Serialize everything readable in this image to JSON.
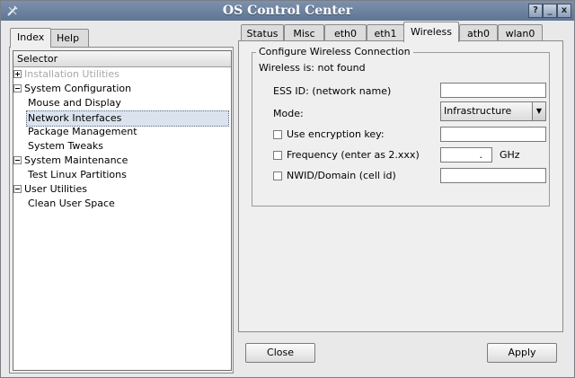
{
  "window": {
    "title": "OS Control Center"
  },
  "titlebar_buttons": {
    "help": "?",
    "minimize": "_",
    "close": "x"
  },
  "left_tabs": [
    {
      "label": "Index"
    },
    {
      "label": "Help"
    }
  ],
  "tree": {
    "header": "Selector",
    "items": [
      {
        "label": "Installation Utilities",
        "expander": "+",
        "disabled": true
      },
      {
        "label": "System Configuration",
        "expander": "-"
      },
      {
        "label": "Mouse and Display"
      },
      {
        "label": "Network Interfaces",
        "selected": true
      },
      {
        "label": "Package Management"
      },
      {
        "label": "System Tweaks"
      },
      {
        "label": "System Maintenance",
        "expander": "-"
      },
      {
        "label": "Test Linux Partitions"
      },
      {
        "label": "User Utilities",
        "expander": "-"
      },
      {
        "label": "Clean User Space"
      }
    ]
  },
  "right_tabs": [
    {
      "label": "Status"
    },
    {
      "label": "Misc"
    },
    {
      "label": "eth0"
    },
    {
      "label": "eth1"
    },
    {
      "label": "Wireless",
      "active": true
    },
    {
      "label": "ath0"
    },
    {
      "label": "wlan0"
    }
  ],
  "wireless": {
    "group_title": "Configure Wireless Connection",
    "status": "Wireless is: not found",
    "essid_label": "ESS ID: (network name)",
    "essid_value": "",
    "mode_label": "Mode:",
    "mode_value": "Infrastructure",
    "encryption_label": "Use encryption key:",
    "encryption_checked": false,
    "encryption_value": "",
    "frequency_label": "Frequency (enter as 2.xxx)",
    "frequency_checked": false,
    "frequency_value": ".",
    "frequency_unit": "GHz",
    "nwid_label": "NWID/Domain (cell id)",
    "nwid_checked": false,
    "nwid_value": ""
  },
  "buttons": {
    "close": "Close",
    "apply": "Apply"
  },
  "colors": {
    "titlebar": "#6f83a0",
    "selection": "#dbe3ef",
    "panel": "#efefef"
  }
}
